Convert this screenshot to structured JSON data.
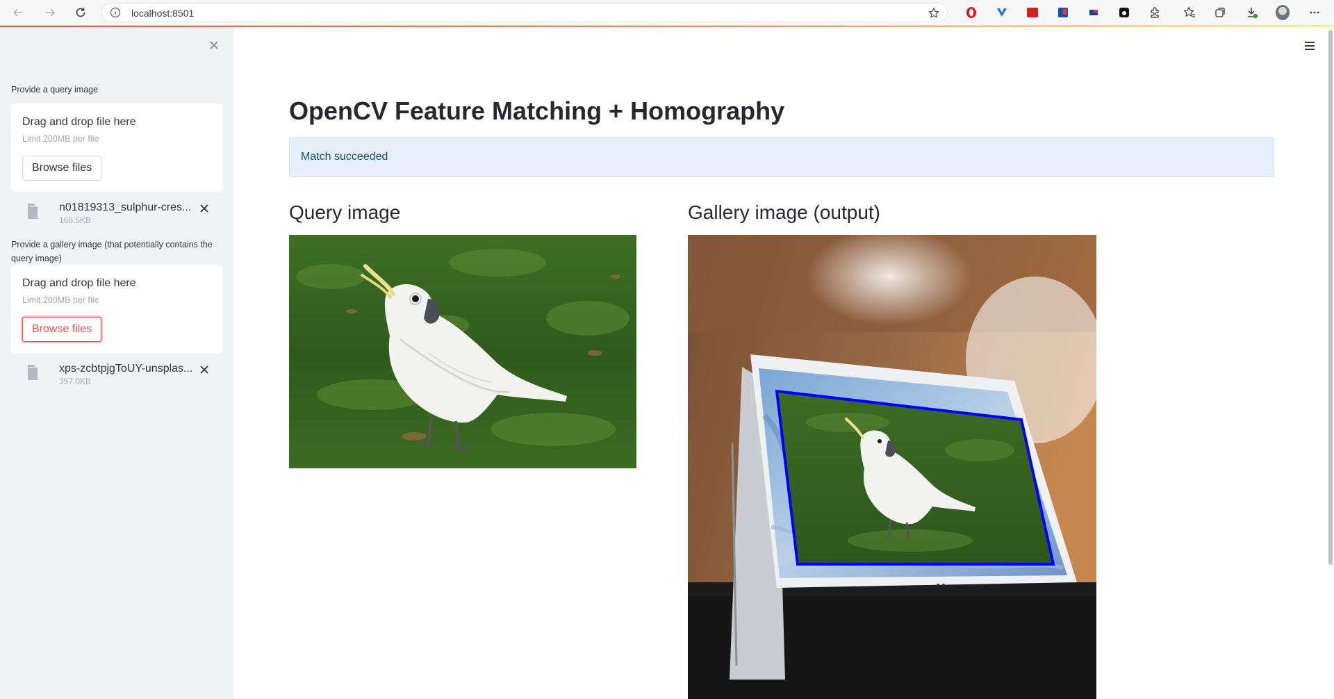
{
  "browser": {
    "url": "localhost:8501"
  },
  "sidebar": {
    "query_uploader": {
      "label": "Provide a query image",
      "dropzone_title": "Drag and drop file here",
      "limit": "Limit 200MB per file",
      "browse_label": "Browse files",
      "file": {
        "name": "n01819313_sulphur-cres...",
        "size": "166.5KB"
      }
    },
    "gallery_uploader": {
      "label": "Provide a gallery image (that potentially contains the query image)",
      "dropzone_title": "Drag and drop file here",
      "limit": "Limit 200MB per file",
      "browse_label": "Browse files",
      "file": {
        "name": "xps-zcbtpjgToUY-unsplas...",
        "size": "357.0KB"
      }
    }
  },
  "main": {
    "title": "OpenCV Feature Matching + Homography",
    "alert": "Match succeeded",
    "columns": [
      {
        "header": "Query image"
      },
      {
        "header": "Gallery image (output)"
      }
    ]
  },
  "colors": {
    "accent": "#ff4b4b",
    "sidebar_bg": "#f0f2f6",
    "alert_bg": "#e7f0fa",
    "homography_box": "#0000ff"
  }
}
